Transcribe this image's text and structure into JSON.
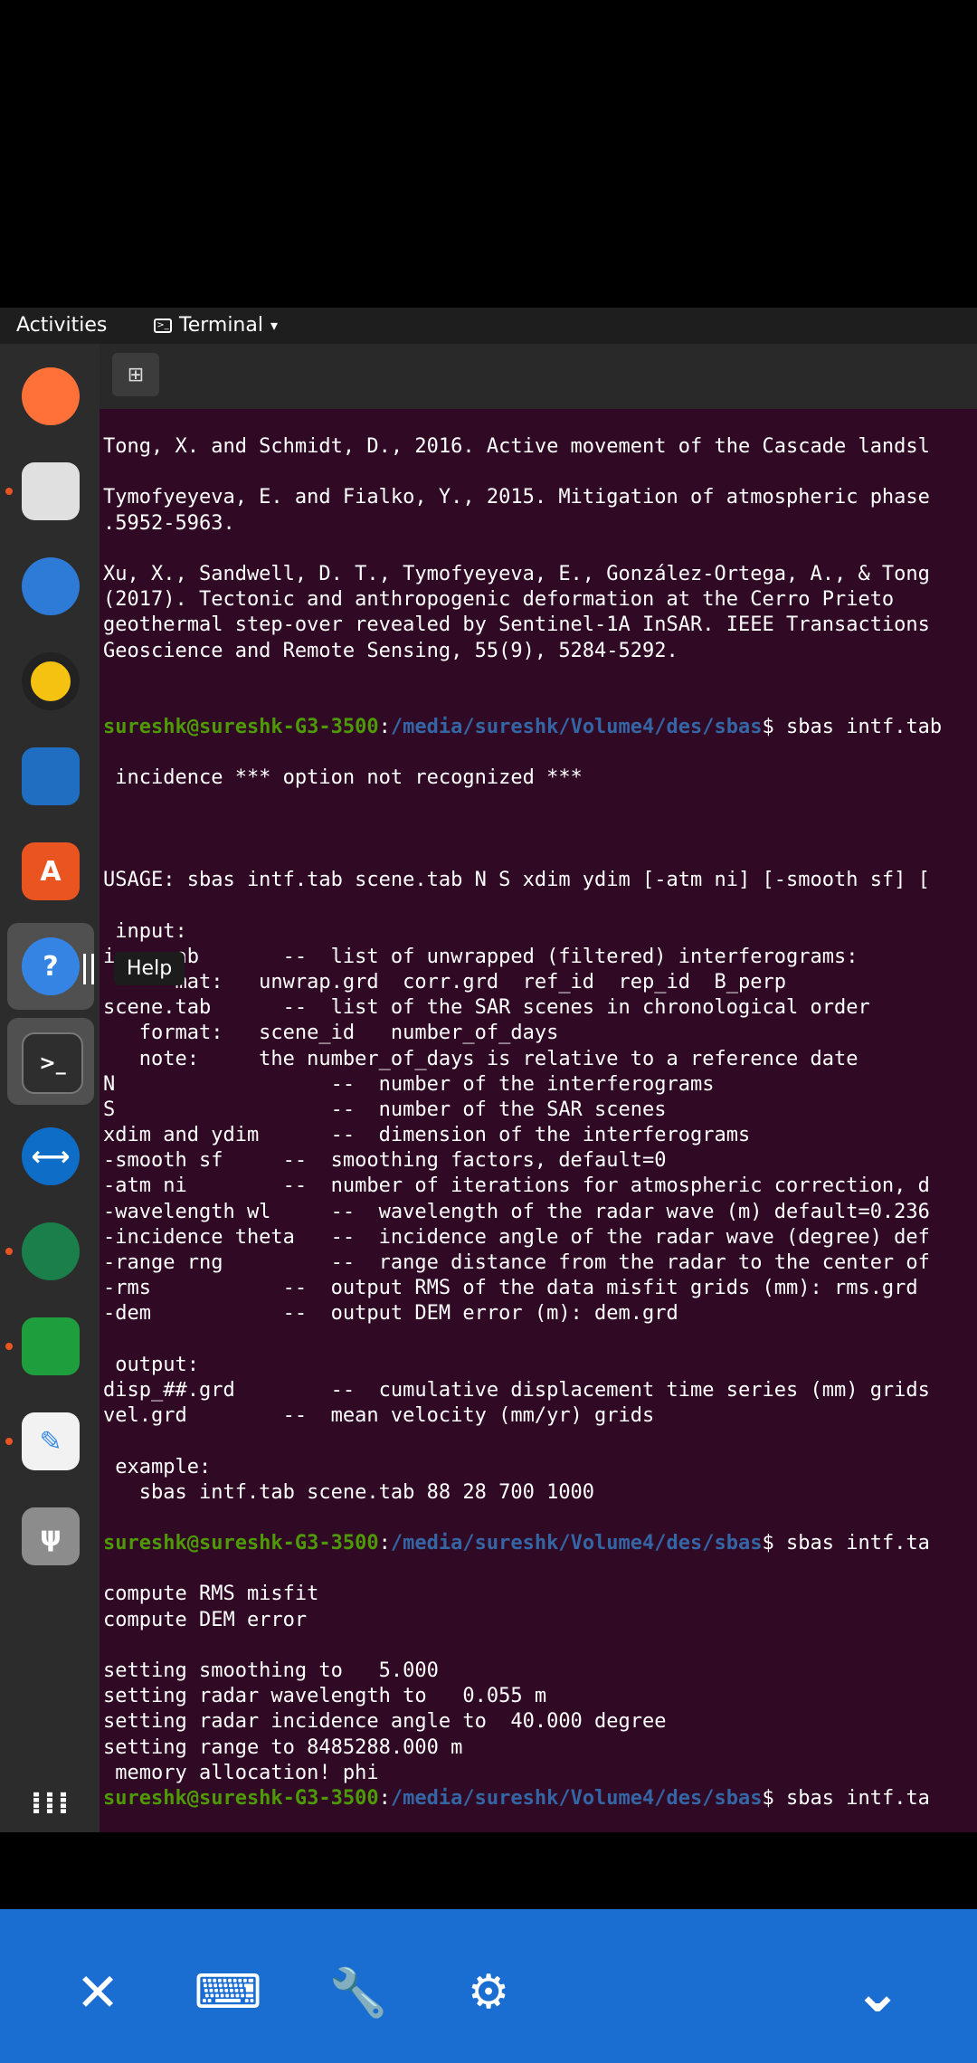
{
  "topbar": {
    "activities": "Activities",
    "app_menu": "Terminal"
  },
  "dock": {
    "apps": [
      {
        "name": "firefox-icon",
        "color": "#ff7139"
      },
      {
        "name": "files-icon",
        "color": "#e0e0e0"
      },
      {
        "name": "thunderbird-icon",
        "color": "#2d7bd6"
      },
      {
        "name": "rhythmbox-icon",
        "color": "#f5c211"
      },
      {
        "name": "libreoffice-writer-icon",
        "color": "#1f6ec1"
      },
      {
        "name": "software-center-icon",
        "color": "#e95420"
      },
      {
        "name": "help-icon",
        "color": "#3584e4"
      },
      {
        "name": "terminal-icon",
        "color": "#2e2e2e"
      },
      {
        "name": "teamviewer-icon",
        "color": "#0e6ec7"
      },
      {
        "name": "webcam-icon",
        "color": "#1a7f4b"
      },
      {
        "name": "libreoffice-calc-icon",
        "color": "#1f9e3d"
      },
      {
        "name": "text-editor-icon",
        "color": "#3a8de8"
      },
      {
        "name": "usb-drive-icon",
        "color": "#8c8c8c"
      }
    ],
    "help_tooltip": "Help"
  },
  "terminal": {
    "lines": [
      {
        "text": "Tong, X. and Schmidt, D., 2016. Active movement of the Cascade landsl"
      },
      {
        "text": ""
      },
      {
        "text": "Tymofyeyeva, E. and Fialko, Y., 2015. Mitigation of atmospheric phase"
      },
      {
        "text": ".5952-5963."
      },
      {
        "text": ""
      },
      {
        "text": "Xu, X., Sandwell, D. T., Tymofyeyeva, E., González-Ortega, A., & Tong"
      },
      {
        "text": "(2017). Tectonic and anthropogenic deformation at the Cerro Prieto"
      },
      {
        "text": "geothermal step-over revealed by Sentinel-1A InSAR. IEEE Transactions"
      },
      {
        "text": "Geoscience and Remote Sensing, 55(9), 5284-5292."
      },
      {
        "text": ""
      },
      {
        "text": ""
      },
      {
        "user": "sureshk@sureshk-G3-3500",
        "path": "/media/sureshk/Volume4/des/sbas",
        "cmd": "$ sbas intf.tab"
      },
      {
        "text": ""
      },
      {
        "text": " incidence *** option not recognized ***"
      },
      {
        "text": ""
      },
      {
        "text": ""
      },
      {
        "text": ""
      },
      {
        "text": "USAGE: sbas intf.tab scene.tab N S xdim ydim [-atm ni] [-smooth sf] ["
      },
      {
        "text": ""
      },
      {
        "text": " input:"
      },
      {
        "text": "i     ab       --  list of unwrapped (filtered) interferograms:"
      },
      {
        "text": "      mat:   unwrap.grd  corr.grd  ref_id  rep_id  B_perp"
      },
      {
        "text": "scene.tab      --  list of the SAR scenes in chronological order"
      },
      {
        "text": "   format:   scene_id   number_of_days"
      },
      {
        "text": "   note:     the number_of_days is relative to a reference date"
      },
      {
        "text": "N                  --  number of the interferograms"
      },
      {
        "text": "S                  --  number of the SAR scenes"
      },
      {
        "text": "xdim and ydim      --  dimension of the interferograms"
      },
      {
        "text": "-smooth sf     --  smoothing factors, default=0"
      },
      {
        "text": "-atm ni        --  number of iterations for atmospheric correction, d"
      },
      {
        "text": "-wavelength wl     --  wavelength of the radar wave (m) default=0.236"
      },
      {
        "text": "-incidence theta   --  incidence angle of the radar wave (degree) def"
      },
      {
        "text": "-range rng         --  range distance from the radar to the center of"
      },
      {
        "text": "-rms           --  output RMS of the data misfit grids (mm): rms.grd"
      },
      {
        "text": "-dem           --  output DEM error (m): dem.grd"
      },
      {
        "text": ""
      },
      {
        "text": " output:"
      },
      {
        "text": "disp_##.grd        --  cumulative displacement time series (mm) grids"
      },
      {
        "text": "vel.grd        --  mean velocity (mm/yr) grids"
      },
      {
        "text": ""
      },
      {
        "text": " example:"
      },
      {
        "text": "   sbas intf.tab scene.tab 88 28 700 1000"
      },
      {
        "text": ""
      },
      {
        "user": "sureshk@sureshk-G3-3500",
        "path": "/media/sureshk/Volume4/des/sbas",
        "cmd": "$ sbas intf.ta"
      },
      {
        "text": ""
      },
      {
        "text": "compute RMS misfit"
      },
      {
        "text": "compute DEM error"
      },
      {
        "text": ""
      },
      {
        "text": "setting smoothing to   5.000"
      },
      {
        "text": "setting radar wavelength to   0.055 m"
      },
      {
        "text": "setting radar incidence angle to  40.000 degree"
      },
      {
        "text": "setting range to 8485288.000 m"
      },
      {
        "text": " memory allocation! phi"
      },
      {
        "user": "sureshk@sureshk-G3-3500",
        "path": "/media/sureshk/Volume4/des/sbas",
        "cmd": "$ sbas intf.ta"
      }
    ]
  },
  "bottom_bar": {
    "buttons": [
      {
        "name": "close-icon",
        "glyph": "✕"
      },
      {
        "name": "keyboard-icon",
        "glyph": "⌨"
      },
      {
        "name": "wrench-icon",
        "glyph": "🔧"
      },
      {
        "name": "gear-icon",
        "glyph": "⚙"
      },
      {
        "name": "chevron-down-icon",
        "glyph": "⌄"
      }
    ]
  }
}
